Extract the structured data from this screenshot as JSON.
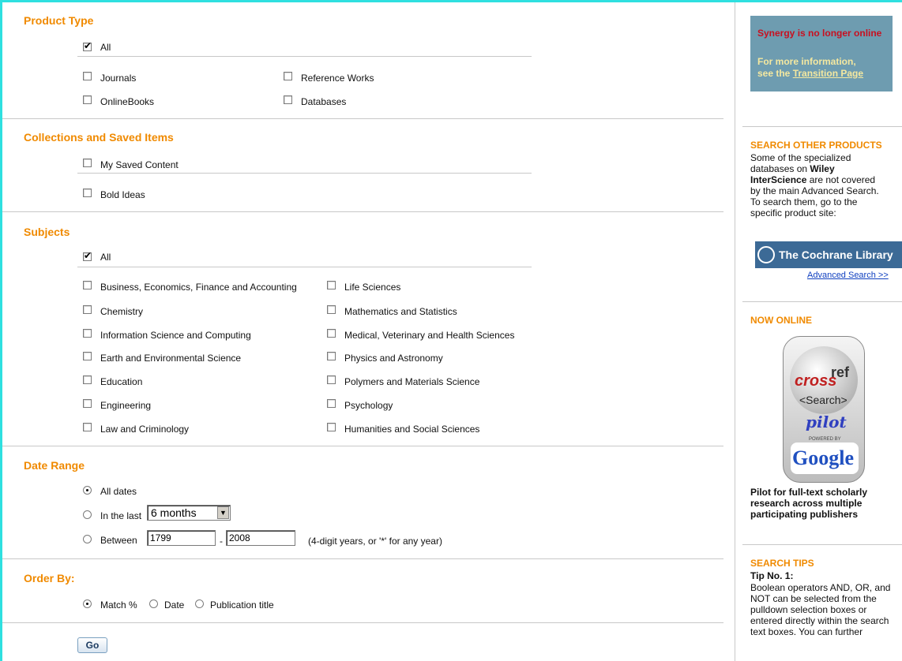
{
  "product_type": {
    "heading": "Product Type",
    "all_label": "All",
    "items": [
      "Journals",
      "Reference Works",
      "OnlineBooks",
      "Databases"
    ]
  },
  "collections": {
    "heading": "Collections and Saved Items",
    "items": [
      "My Saved Content",
      "Bold Ideas"
    ]
  },
  "subjects": {
    "heading": "Subjects",
    "all_label": "All",
    "left": [
      "Business, Economics, Finance and Accounting",
      "Chemistry",
      "Information Science and Computing",
      "Earth and Environmental Science",
      "Education",
      "Engineering",
      "Law and Criminology"
    ],
    "right": [
      "Life Sciences",
      "Mathematics and Statistics",
      "Medical, Veterinary and Health Sciences",
      "Physics and Astronomy",
      "Polymers and Materials Science",
      "Psychology",
      "Humanities and Social Sciences"
    ]
  },
  "date_range": {
    "heading": "Date Range",
    "all_dates": "All dates",
    "in_the_last": "In the last",
    "last_value": "6 months",
    "between": "Between",
    "from_year": "1799",
    "dash": "-",
    "to_year": "2008",
    "hint": "(4-digit years, or '*' for any year)"
  },
  "order_by": {
    "heading": "Order By:",
    "options": [
      "Match %",
      "Date",
      "Publication title"
    ]
  },
  "go_label": "Go",
  "sidebar": {
    "banner_line1": "Synergy is no longer online",
    "banner_line2": "For more information,",
    "banner_line3_pre": "see the ",
    "banner_link": "Transition Page",
    "search_other_heading": "SEARCH OTHER PRODUCTS",
    "search_other_text1": "Some of the specialized",
    "search_other_text2": "databases on ",
    "search_other_bold1": "Wiley",
    "search_other_bold2": "InterScience",
    "search_other_text3": " are not covered",
    "search_other_text4": "by the main Advanced Search.",
    "search_other_text5": "To search them, go to the",
    "search_other_text6": "specific product site:",
    "cochrane_label": "The Cochrane Library",
    "advanced_search_link": "Advanced Search >>",
    "now_online_heading": "NOW ONLINE",
    "crossref_top": "cross",
    "crossref_ref": "ref",
    "crossref_search": "<Search>",
    "crossref_pilot": "pilot",
    "crossref_powered": "POWERED BY",
    "crossref_google": "Google",
    "pilot_text1": "Pilot for full-text scholarly",
    "pilot_text2": "research across multiple",
    "pilot_text3": "participating publishers",
    "tips_heading": "SEARCH TIPS",
    "tip_title": "Tip No. 1:",
    "tip_lines": [
      "Boolean operators AND, OR, and",
      "NOT can be selected from the",
      "pulldown selection boxes or",
      "entered directly within the search",
      "text boxes. You can further"
    ]
  }
}
